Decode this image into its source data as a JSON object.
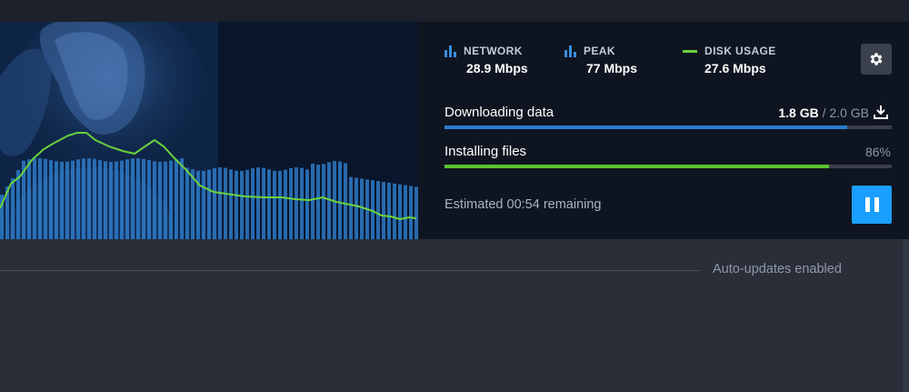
{
  "stats": {
    "network": {
      "label": "NETWORK",
      "value": "28.9 Mbps",
      "icon": "bar-chart-icon"
    },
    "peak": {
      "label": "PEAK",
      "value": "77 Mbps",
      "icon": "bar-chart-icon"
    },
    "disk": {
      "label": "DISK USAGE",
      "value": "27.6 Mbps",
      "icon": "line-legend-icon"
    }
  },
  "download": {
    "label": "Downloading data",
    "done": "1.8 GB",
    "separator": " / ",
    "total": "2.0 GB",
    "progress": 0.9
  },
  "install": {
    "label": "Installing files",
    "percent_text": "86%",
    "progress": 0.86
  },
  "estimated": "Estimated 00:54 remaining",
  "auto_updates": "Auto-updates enabled",
  "colors": {
    "network_bars": "#2f7fd0",
    "disk_line": "#6ad13d",
    "download_fill": "#2a7dd0",
    "install_fill": "#5ac232",
    "pause_button": "#1a9fff"
  }
}
